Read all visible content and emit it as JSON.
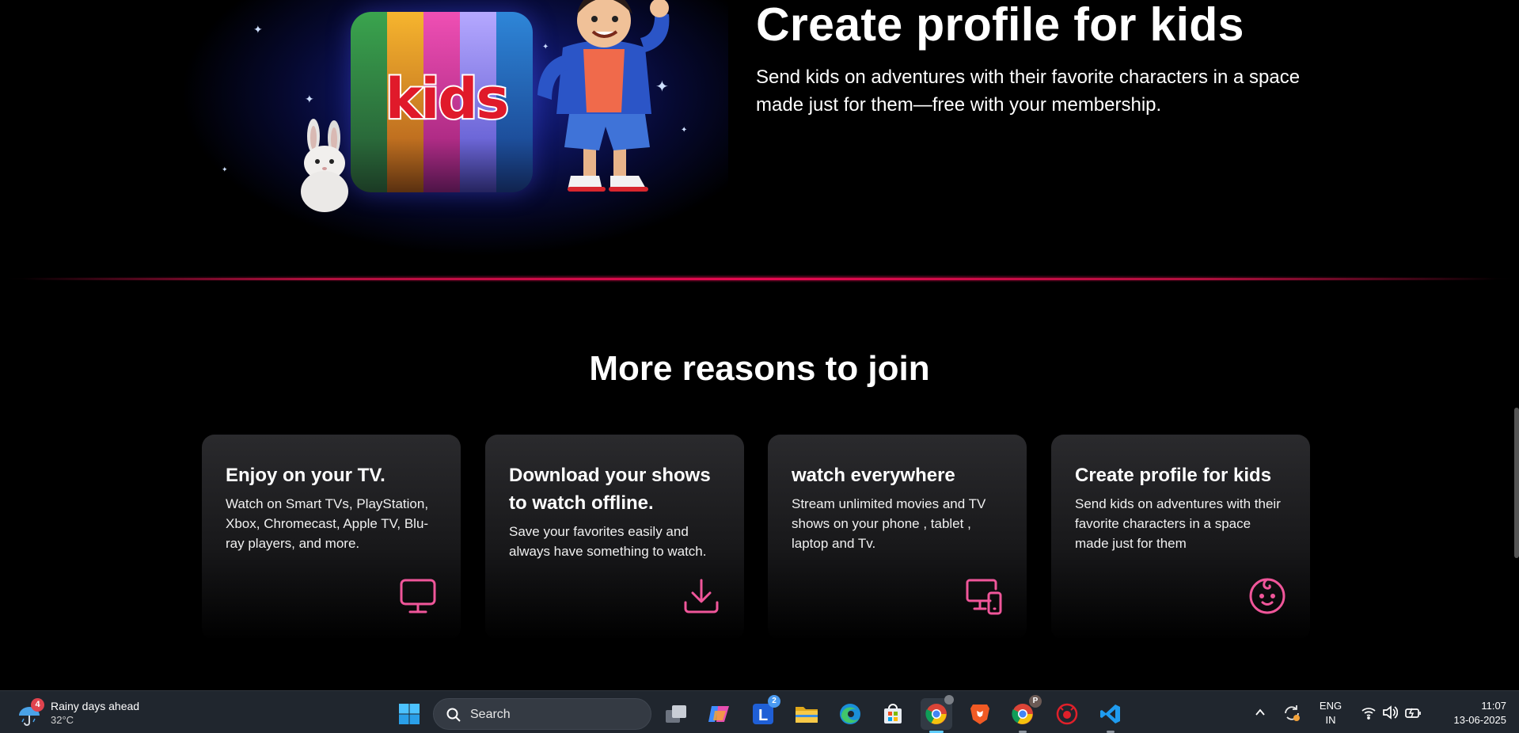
{
  "hero": {
    "title": "Create profile for kids",
    "description": "Send kids on adventures with their favorite characters in a space made just for them—free with your membership.",
    "art_text": "kids"
  },
  "reasons": {
    "title": "More reasons to join",
    "cards": [
      {
        "title": "Enjoy on your TV.",
        "text": "Watch on Smart TVs, PlayStation, Xbox, Chromecast, Apple TV, Blu-ray players, and more.",
        "icon": "tv-icon"
      },
      {
        "title": "Download your shows to watch offline.",
        "text": "Save your favorites easily and always have something to watch.",
        "icon": "download-icon"
      },
      {
        "title": "watch everywhere",
        "text": "Stream unlimited movies and TV shows on your phone , tablet , laptop and Tv.",
        "icon": "devices-icon"
      },
      {
        "title": "Create profile for kids",
        "text": "Send kids on adventures with their favorite characters in a space made just for them",
        "icon": "baby-face-icon"
      }
    ]
  },
  "colors": {
    "accent": "#e50950",
    "icon_pink": "#f0569a",
    "card_bg": "#232326",
    "taskbar": "#20262e"
  },
  "taskbar": {
    "weather": {
      "title": "Rainy days ahead",
      "temp": "32°C",
      "badge": "4",
      "icon": "umbrella-icon"
    },
    "search_label": "Search",
    "apps": [
      {
        "name": "start-button",
        "icon": "windows-logo-icon"
      },
      {
        "name": "task-view-button",
        "icon": "task-view-icon"
      },
      {
        "name": "copilot-app",
        "icon": "copilot-icon"
      },
      {
        "name": "l-app",
        "icon": "l-app-icon",
        "badge": "2"
      },
      {
        "name": "file-explorer-app",
        "icon": "folder-icon"
      },
      {
        "name": "edge-app",
        "icon": "edge-icon"
      },
      {
        "name": "store-app",
        "icon": "store-icon"
      },
      {
        "name": "chrome-app",
        "icon": "chrome-icon"
      },
      {
        "name": "brave-app",
        "icon": "brave-icon"
      },
      {
        "name": "chrome-profile-app",
        "icon": "chrome-icon",
        "badge": "P"
      },
      {
        "name": "red-app",
        "icon": "bug-icon"
      },
      {
        "name": "vscode-app",
        "icon": "vscode-icon"
      }
    ],
    "language": {
      "line1": "ENG",
      "line2": "IN"
    },
    "clock": {
      "time": "11:07",
      "date": "13-06-2025"
    }
  }
}
